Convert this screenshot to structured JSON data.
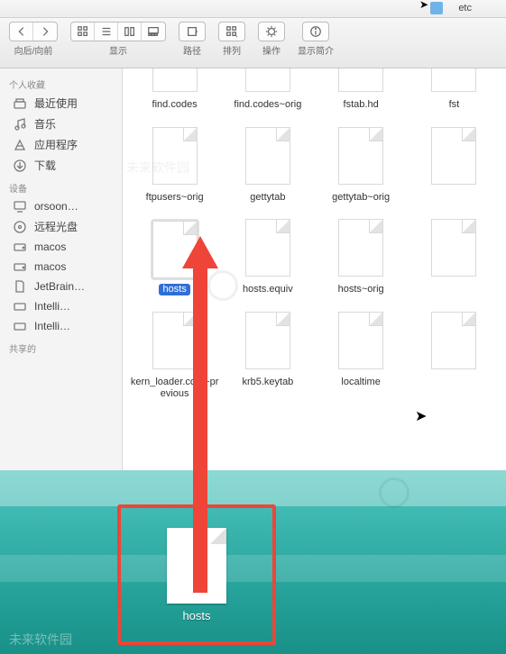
{
  "title": {
    "folder": "etc"
  },
  "toolbar": {
    "nav_label": "向后/向前",
    "view_label": "显示",
    "path_label": "路径",
    "arrange_label": "排列",
    "action_label": "操作",
    "info_label": "显示简介"
  },
  "sidebar": {
    "sections": [
      {
        "header": "个人收藏",
        "items": [
          {
            "icon": "all-files-icon",
            "label": "最近使用"
          },
          {
            "icon": "music-icon",
            "label": "音乐"
          },
          {
            "icon": "apps-icon",
            "label": "应用程序"
          },
          {
            "icon": "downloads-icon",
            "label": "下载"
          }
        ]
      },
      {
        "header": "设备",
        "items": [
          {
            "icon": "computer-icon",
            "label": "orsoon…"
          },
          {
            "icon": "disc-icon",
            "label": "远程光盘"
          },
          {
            "icon": "drive-icon",
            "label": "macos"
          },
          {
            "icon": "drive-icon",
            "label": "macos"
          },
          {
            "icon": "document-icon",
            "label": "JetBrain…"
          },
          {
            "icon": "drive-icon",
            "label": "Intelli…"
          },
          {
            "icon": "drive-icon",
            "label": "Intelli…"
          }
        ]
      },
      {
        "header": "共享的",
        "items": []
      }
    ]
  },
  "files": {
    "row0": [
      {
        "name": "find.codes"
      },
      {
        "name": "find.codes~orig"
      },
      {
        "name": "fstab.hd"
      },
      {
        "name": "fst"
      }
    ],
    "row1": [
      {
        "name": "ftpusers~orig"
      },
      {
        "name": "gettytab"
      },
      {
        "name": "gettytab~orig"
      },
      {
        "name": ""
      }
    ],
    "row2": [
      {
        "name": "hosts",
        "selected": true
      },
      {
        "name": "hosts.equiv"
      },
      {
        "name": "hosts~orig"
      },
      {
        "name": ""
      }
    ],
    "row3": [
      {
        "name": "kern_loader.conf~previous"
      },
      {
        "name": "krb5.keytab"
      },
      {
        "name": "localtime"
      },
      {
        "name": ""
      }
    ]
  },
  "desktop_file": {
    "name": "hosts"
  },
  "watermark": {
    "text": "未来软件园"
  }
}
